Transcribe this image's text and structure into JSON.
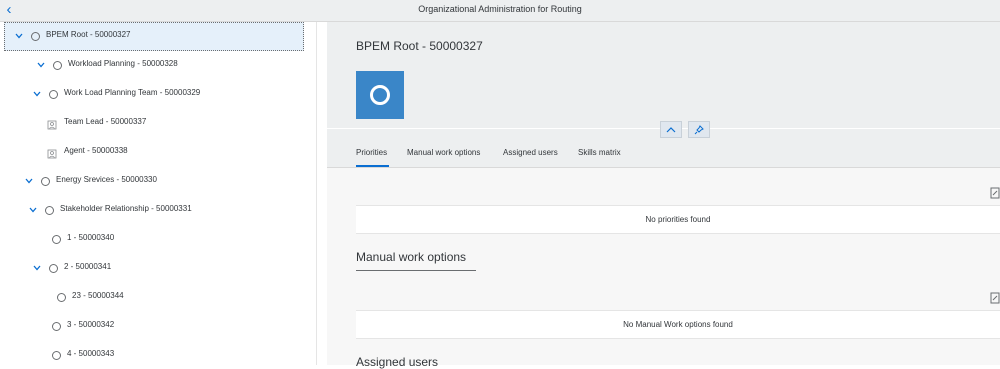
{
  "shell": {
    "title": "Organizational Administration for Routing",
    "back_icon": "chevron-left-icon"
  },
  "tree": {
    "nodes": [
      {
        "label": "BPEM Root - 50000327",
        "kind": "org-unit",
        "expanded": true,
        "selected": true
      },
      {
        "label": "Workload Planning - 50000328",
        "kind": "org-unit",
        "expanded": true
      },
      {
        "label": "Work Load Planning Team - 50000329",
        "kind": "org-unit",
        "expanded": true
      },
      {
        "label": "Team Lead - 50000337",
        "kind": "position"
      },
      {
        "label": "Agent - 50000338",
        "kind": "position"
      },
      {
        "label": "Energy Srevices - 50000330",
        "kind": "org-unit",
        "expanded": true
      },
      {
        "label": "Stakeholder Relationship - 50000331",
        "kind": "org-unit",
        "expanded": true
      },
      {
        "label": "1 - 50000340",
        "kind": "org-unit"
      },
      {
        "label": "2 - 50000341",
        "kind": "org-unit",
        "expanded": true
      },
      {
        "label": "23 - 50000344",
        "kind": "org-unit"
      },
      {
        "label": "3 - 50000342",
        "kind": "org-unit"
      },
      {
        "label": "4 - 50000343",
        "kind": "org-unit"
      }
    ]
  },
  "object": {
    "title": "BPEM Root - 50000327",
    "avatar_icon": "org-unit-circle-icon",
    "avatar_color": "#3a86c8"
  },
  "header_actions": {
    "collapse_icon": "chevron-up-icon",
    "pin_icon": "pin-icon"
  },
  "tabs": [
    {
      "label": "Priorities",
      "selected": true
    },
    {
      "label": "Manual work options"
    },
    {
      "label": "Assigned users"
    },
    {
      "label": "Skills matrix"
    }
  ],
  "sections": {
    "priorities": {
      "empty_text": "No priorities found"
    },
    "manual_work": {
      "title": "Manual work options",
      "empty_text": "No Manual Work options found"
    },
    "assigned_users": {
      "title": "Assigned users"
    }
  },
  "colors": {
    "accent": "#0a6ed1",
    "header_bg": "#edeff0",
    "selection_bg": "#e5f0fa"
  }
}
